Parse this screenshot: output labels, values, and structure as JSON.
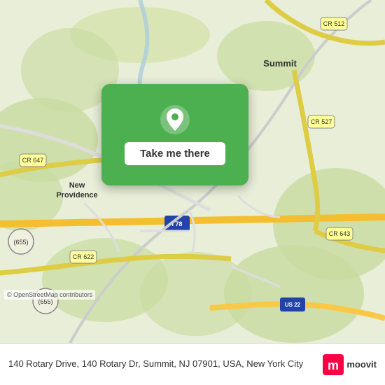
{
  "map": {
    "alt": "Map showing Summit, NJ area"
  },
  "card": {
    "button_label": "Take me there"
  },
  "bottom_bar": {
    "address": "140 Rotary Drive, 140 Rotary Dr, Summit, NJ 07901, USA, New York City"
  },
  "credits": {
    "osm": "© OpenStreetMap contributors"
  },
  "moovit": {
    "label": "moovit"
  },
  "road_labels": {
    "cr647": "CR 647",
    "cr512": "CR 512",
    "cr527": "CR 527",
    "cr622": "CR 622",
    "cr643": "CR 643",
    "i78": "I 78",
    "us22": "US 22",
    "r655a": "(655)",
    "r655b": "(655)",
    "summit": "Summit",
    "new_providence": "New\nProvidence"
  }
}
